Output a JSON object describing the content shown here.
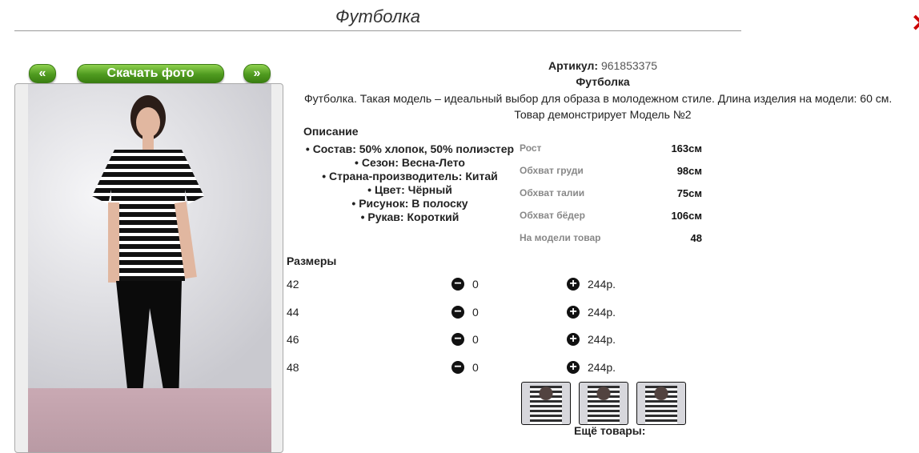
{
  "header": {
    "title": "Футболка"
  },
  "gallery": {
    "prev_label": "«",
    "next_label": "»",
    "download_label": "Скачать фото"
  },
  "product": {
    "article_label": "Артикул:",
    "article_value": "961853375",
    "name": "Футболка",
    "description": "Футболка. Такая модель – идеальный выбор для образа в молодежном стиле. Длина изделия на модели: 60 см.",
    "model_note": "Товар демонстрирует Модель №2",
    "desc_heading": "Описание",
    "attributes": [
      "Состав: 50% хлопок, 50% полиэстер",
      "Сезон: Весна-Лето",
      "Страна-производитель: Китай",
      "Цвет: Чёрный",
      "Рисунок: В полоску",
      "Рукав: Короткий"
    ],
    "measurements": [
      {
        "label": "Рост",
        "value": "163см"
      },
      {
        "label": "Обхват груди",
        "value": "98см"
      },
      {
        "label": "Обхват талии",
        "value": "75см"
      },
      {
        "label": "Обхват бёдер",
        "value": "106см"
      },
      {
        "label": "На модели товар",
        "value": "48"
      }
    ]
  },
  "sizes": {
    "heading": "Размеры",
    "rows": [
      {
        "size": "42",
        "qty": "0",
        "price": "244р."
      },
      {
        "size": "44",
        "qty": "0",
        "price": "244р."
      },
      {
        "size": "46",
        "qty": "0",
        "price": "244р."
      },
      {
        "size": "48",
        "qty": "0",
        "price": "244р."
      }
    ]
  },
  "more": {
    "label": "Ещё товары:"
  },
  "colors": {
    "accent_green": "#4f9a1f",
    "close_red": "#cc0000"
  }
}
